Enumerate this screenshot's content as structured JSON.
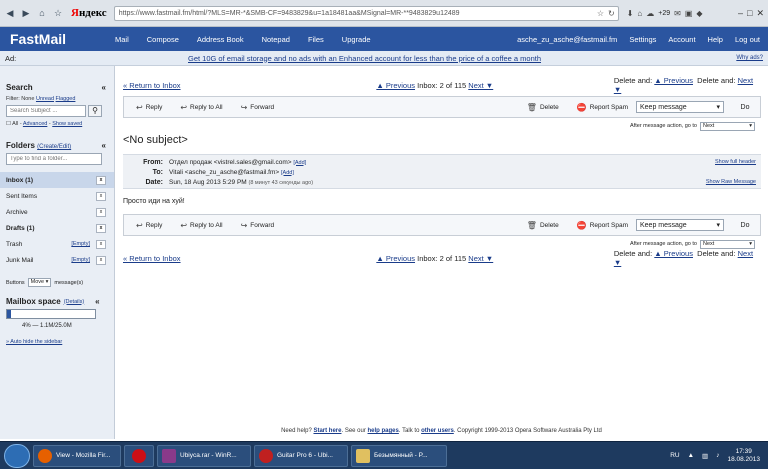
{
  "browser": {
    "url": "https://www.fastmail.fm/html/?MLS=MR-*&SMB-CF=9483829&u=1a18481aa&MSignal=MR-**9483829u12489",
    "search_engine": "Яндекс",
    "weather": "+29"
  },
  "app": {
    "logo": "FastMail",
    "nav": [
      "Mail",
      "Compose",
      "Address Book",
      "Notepad",
      "Files",
      "Upgrade"
    ],
    "account": "asche_zu_asche@fastmail.fm",
    "right_nav": [
      "Settings",
      "Account",
      "Help",
      "Log out"
    ]
  },
  "ad": {
    "label": "Ad:",
    "text": "Get 10G of email storage and no ads with an Enhanced account for less than the price of a coffee a month",
    "why": "Why ads?"
  },
  "sidebar": {
    "search_title": "Search",
    "filter_prefix": "Filter: None",
    "filter_unread": "Unread",
    "filter_flagged": "Flagged",
    "search_placeholder": "Search Subject ...",
    "opt_all": "All",
    "opt_advanced": "Advanced",
    "opt_saved": "Show saved",
    "folders_title": "Folders",
    "folders_link": "(Create/Edit)",
    "folder_placeholder": "Type to find a folder...",
    "folders": [
      {
        "name": "Inbox (1)",
        "empty": ""
      },
      {
        "name": "Sent Items",
        "empty": ""
      },
      {
        "name": "Archive",
        "empty": ""
      },
      {
        "name": "Drafts (1)",
        "empty": ""
      },
      {
        "name": "Trash",
        "empty": "[Empty]"
      },
      {
        "name": "Junk Mail",
        "empty": "[Empty]"
      }
    ],
    "buttons_label": "Buttons",
    "buttons_value": "Move",
    "buttons_suffix": "message(s)",
    "space_title": "Mailbox space",
    "space_link": "(Details)",
    "space_fraction": 0.04,
    "space_text": "4% — 1.1M/25.0M",
    "hide_link": "» Auto hide the sidebar"
  },
  "message": {
    "return_link": "« Return to Inbox",
    "prev_link": "▲ Previous",
    "inbox_pos": "Inbox: 2 of 115",
    "next_link": "Next ▼",
    "delete_and": "Delete and:",
    "delete_prev": "▲ Previous",
    "delete_next": "Next ▼",
    "actions": {
      "reply": "Reply",
      "reply_all": "Reply to All",
      "forward": "Forward",
      "delete": "Delete",
      "report_spam": "Report Spam",
      "keep": "Keep message",
      "do": "Do"
    },
    "after_label": "After message action, go to",
    "after_value": "Next",
    "subject": "<No subject>",
    "from_label": "From:",
    "from_value": "Отдел продаж <vistrel.sales@gmail.com>",
    "to_label": "To:",
    "to_value": "Vitali <asche_zu_asche@fastmail.fm>",
    "date_label": "Date:",
    "date_value": "Sun, 18 Aug 2013 5:29 PM",
    "date_ago": "(8 минут 43 секунды ago)",
    "add": "[Add]",
    "show_full_header": "Show full header",
    "show_raw": "Show Raw Message",
    "body": "Просто иди на хуй!"
  },
  "footer": {
    "need_help": "Need help?",
    "start_here": "Start here",
    "see_our": ". See our",
    "help_pages": "help pages",
    "talk": ". Talk to",
    "other_users": "other users",
    "copyright": ". Copyright 1999-2013 Opera Software Australia Pty Ltd"
  },
  "taskbar": {
    "tasks": [
      "View - Mozilla Fir...",
      "Ubiycа.rar - WinR...",
      "Guitar Pro 6 - Ubi...",
      "Безымянный - P..."
    ],
    "lang": "RU",
    "time": "17:39",
    "date": "18.08.2013"
  }
}
